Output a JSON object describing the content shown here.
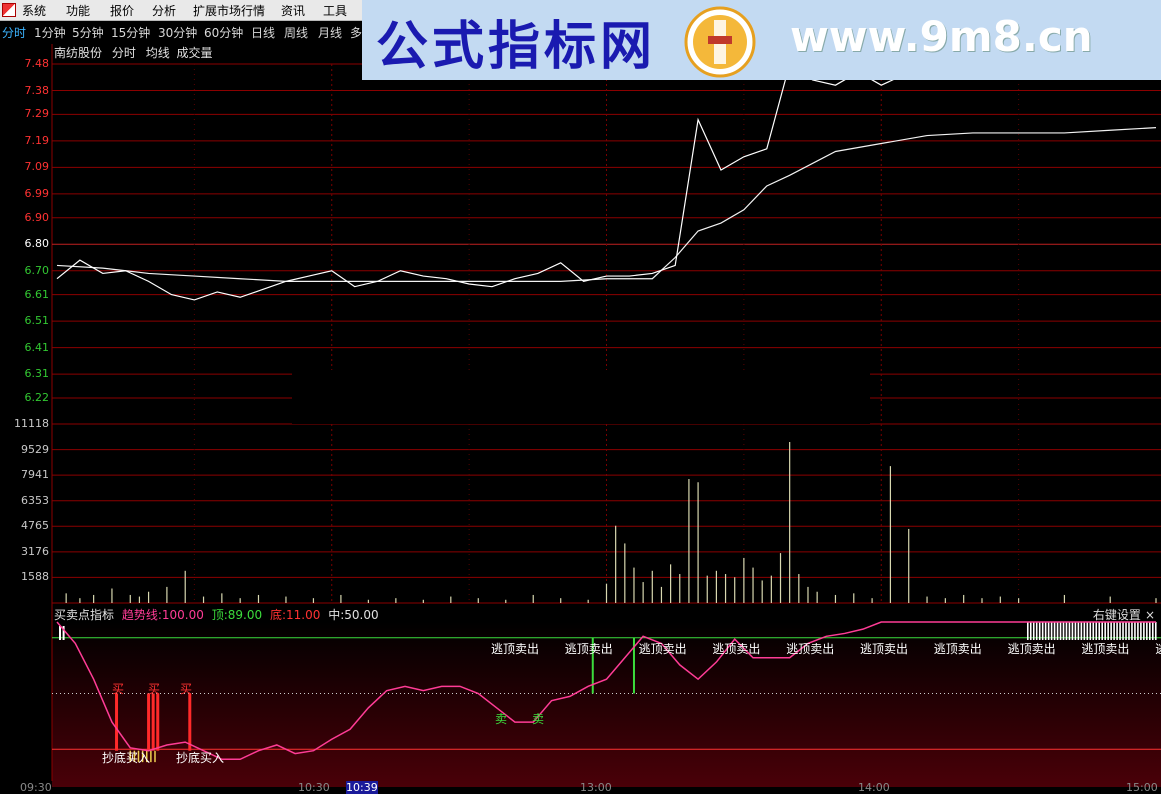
{
  "menu": {
    "items": [
      "系统",
      "功能",
      "报价",
      "分析",
      "扩展市场行情",
      "资讯",
      "工具"
    ]
  },
  "periods": {
    "items": [
      "分时",
      "1分钟",
      "5分钟",
      "15分钟",
      "30分钟",
      "60分钟",
      "日线",
      "周线",
      "月线",
      "多"
    ],
    "active_index": 0
  },
  "banner": {
    "title": "公式指标网",
    "url": "www.9m8.cn",
    "seal_text": "www.9m8.cn"
  },
  "chart_header": {
    "stock_name": "南纺股份",
    "mode": "分时",
    "ma_label": "均线",
    "volume_label": "成交量"
  },
  "colors": {
    "grid": "#8b0000",
    "up": "#ff3232",
    "down": "#32c832",
    "base": "#ffffff",
    "price_line": "#ffffff",
    "avg_line": "#ffffff",
    "volume_bar": "#d8d8b0",
    "indicator_line": "#ff3c96",
    "buy_bar": "#ff2a2a",
    "sell_line": "#3cdc3c"
  },
  "chart_data": [
    {
      "type": "line",
      "price_axis_labels": [
        "7.48",
        "7.38",
        "7.29",
        "7.19",
        "7.09",
        "6.99",
        "6.90",
        "6.80",
        "6.70",
        "6.61",
        "6.51",
        "6.41",
        "6.31",
        "6.22"
      ],
      "ylim": [
        6.22,
        7.48
      ],
      "reference_price": 6.8,
      "time_labels": [
        "09:30",
        "10:30",
        "10:39",
        "13:00",
        "14:00",
        "15:00"
      ],
      "series": [
        {
          "x": [
            0,
            5,
            10,
            15,
            20,
            25,
            30,
            35,
            40,
            45,
            50,
            55,
            60,
            65,
            70,
            75,
            80,
            85,
            90,
            95,
            100,
            105,
            110,
            115,
            120,
            125,
            130,
            135,
            140,
            145,
            150,
            155,
            160,
            165,
            170,
            175,
            180,
            185,
            190,
            195,
            200,
            205,
            210,
            215,
            220,
            225,
            230,
            235,
            240
          ],
          "values": [
            6.67,
            6.74,
            6.69,
            6.7,
            6.66,
            6.61,
            6.59,
            6.62,
            6.6,
            6.63,
            6.66,
            6.68,
            6.7,
            6.64,
            6.66,
            6.7,
            6.68,
            6.67,
            6.65,
            6.64,
            6.67,
            6.69,
            6.73,
            6.66,
            6.68,
            6.68,
            6.69,
            6.72,
            7.27,
            7.08,
            7.13,
            7.16,
            7.48,
            7.42,
            7.4,
            7.45,
            7.4,
            7.44,
            7.52,
            7.55,
            7.56,
            7.55,
            7.57,
            7.55,
            7.58,
            7.57,
            7.56,
            7.57,
            7.55
          ]
        },
        {
          "x": [
            0,
            10,
            20,
            30,
            40,
            50,
            60,
            70,
            80,
            90,
            100,
            110,
            120,
            130,
            135,
            140,
            145,
            150,
            155,
            160,
            170,
            180,
            190,
            200,
            210,
            220,
            230,
            240
          ],
          "values": [
            6.72,
            6.71,
            6.69,
            6.68,
            6.67,
            6.66,
            6.66,
            6.66,
            6.66,
            6.66,
            6.66,
            6.66,
            6.67,
            6.67,
            6.75,
            6.85,
            6.88,
            6.93,
            7.02,
            7.06,
            7.15,
            7.18,
            7.21,
            7.22,
            7.22,
            7.22,
            7.23,
            7.24
          ]
        }
      ]
    },
    {
      "type": "bar",
      "axis_labels": [
        "11118",
        "9529",
        "7941",
        "6353",
        "4765",
        "3176",
        "1588"
      ],
      "ylim": [
        0,
        11118
      ],
      "x": [
        2,
        5,
        8,
        12,
        16,
        18,
        20,
        24,
        28,
        32,
        36,
        40,
        44,
        50,
        56,
        62,
        68,
        74,
        80,
        86,
        92,
        98,
        104,
        110,
        116,
        120,
        122,
        124,
        126,
        128,
        130,
        132,
        134,
        136,
        138,
        140,
        142,
        144,
        146,
        148,
        150,
        152,
        154,
        156,
        158,
        160,
        162,
        164,
        166,
        170,
        174,
        178,
        182,
        186,
        190,
        194,
        198,
        202,
        206,
        210,
        220,
        230,
        240
      ],
      "values": [
        600,
        300,
        500,
        900,
        500,
        400,
        700,
        1000,
        2000,
        400,
        600,
        300,
        500,
        400,
        300,
        500,
        200,
        300,
        200,
        400,
        300,
        200,
        500,
        300,
        200,
        1200,
        4800,
        3700,
        2200,
        1300,
        2000,
        1000,
        2400,
        1800,
        7700,
        7500,
        1700,
        2000,
        1800,
        1600,
        2800,
        2200,
        1400,
        1700,
        3100,
        10000,
        1800,
        1000,
        700,
        500,
        600,
        300,
        8500,
        4600,
        400,
        300,
        500,
        300,
        400,
        300,
        500,
        400,
        300
      ]
    },
    {
      "type": "line",
      "indicator": {
        "name": "买卖点指标",
        "trend_label": "趋势线:",
        "trend_value": "100.00",
        "top_label": "顶:",
        "top_value": "89.00",
        "bottom_label": "底:",
        "bottom_value": "11.00",
        "mid_label": "中:",
        "mid_value": "50.00"
      },
      "ylim": [
        0,
        100
      ],
      "x": [
        0,
        4,
        8,
        12,
        16,
        20,
        24,
        28,
        32,
        36,
        40,
        44,
        48,
        52,
        56,
        60,
        64,
        68,
        72,
        76,
        80,
        84,
        88,
        92,
        96,
        100,
        104,
        108,
        112,
        116,
        120,
        124,
        128,
        132,
        136,
        140,
        144,
        148,
        152,
        156,
        160,
        164,
        168,
        172,
        176,
        180,
        184,
        188,
        192,
        196,
        200,
        204,
        208,
        212,
        216,
        220,
        224,
        228,
        232,
        236,
        240
      ],
      "values": [
        100,
        85,
        60,
        30,
        12,
        10,
        14,
        16,
        10,
        4,
        4,
        10,
        14,
        8,
        10,
        18,
        25,
        40,
        52,
        55,
        52,
        55,
        55,
        50,
        40,
        30,
        30,
        45,
        48,
        55,
        60,
        75,
        90,
        85,
        70,
        60,
        72,
        88,
        75,
        75,
        75,
        85,
        90,
        92,
        95,
        100,
        100,
        100,
        100,
        100,
        100,
        100,
        100,
        100,
        100,
        100,
        100,
        100,
        100,
        100,
        100
      ],
      "buy_labels": [
        "买",
        "买",
        "买"
      ],
      "bottom_buy_labels": [
        "抄底买入",
        "抄底买入"
      ],
      "sell_top_labels": [
        "逃顶卖出",
        "逃顶卖出",
        "逃顶卖出",
        "逃顶卖出",
        "逃顶卖出",
        "逃顶卖出",
        "逃顶卖出",
        "逃顶卖出",
        "逃顶卖出",
        "逃"
      ],
      "sell_labels": [
        "卖",
        "卖"
      ]
    }
  ],
  "right_settings": {
    "label": "右键设置",
    "close": "×"
  }
}
